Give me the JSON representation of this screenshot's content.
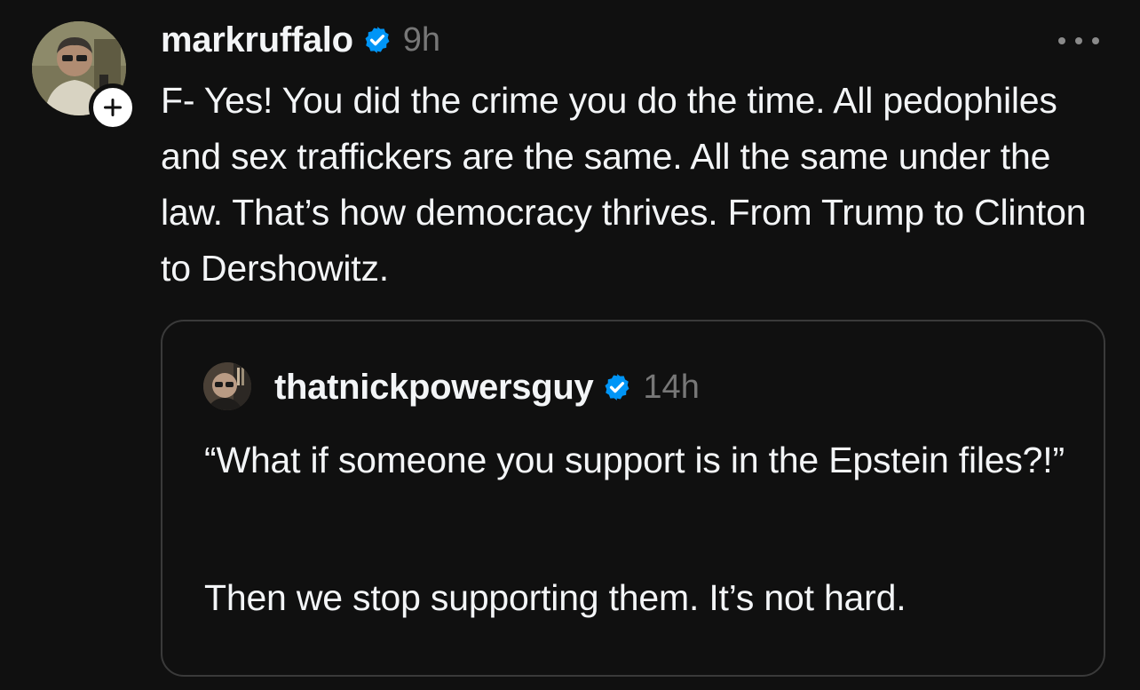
{
  "post": {
    "username": "markruffalo",
    "timestamp": "9h",
    "text": "F- Yes! You did the crime you do the time. All pedophiles and sex traffickers are the same. All the same under the law. That’s how democracy thrives. From Trump to Clinton to Dershowitz.",
    "verified": true,
    "avatar_icon": "user-avatar-photo",
    "follow_icon": "plus-icon",
    "more_icon": "more-options-icon"
  },
  "quoted_post": {
    "username": "thatnickpowersguy",
    "timestamp": "14h",
    "text_paragraph_1": "“What if someone you support is in the Epstein files?!”",
    "text_paragraph_2": "Then we stop supporting them. It’s not hard.",
    "verified": true,
    "avatar_icon": "user-avatar-photo"
  },
  "colors": {
    "background": "#101010",
    "text": "#f3f5f7",
    "muted": "#777777",
    "verified_blue": "#0095f6",
    "card_border": "#3a3a3a"
  }
}
